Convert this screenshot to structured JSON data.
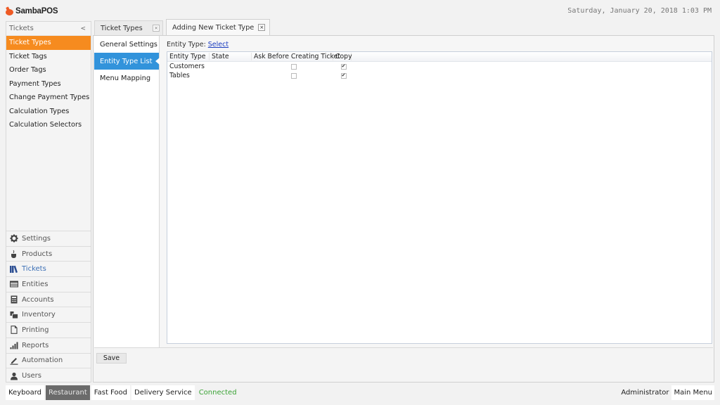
{
  "app": {
    "title": "SambaPOS",
    "datetime": "Saturday, January 20, 2018 1:03 PM"
  },
  "sidebar": {
    "header": "Tickets",
    "collapse_icon": "chevron-left-icon",
    "collapse_glyph": "<",
    "sub_items": [
      {
        "label": "Ticket Types",
        "active": true
      },
      {
        "label": "Ticket Tags"
      },
      {
        "label": "Order Tags"
      },
      {
        "label": "Payment Types"
      },
      {
        "label": "Change Payment Types"
      },
      {
        "label": "Calculation Types"
      },
      {
        "label": "Calculation Selectors"
      }
    ],
    "nav_items": [
      {
        "label": "Settings",
        "icon": "gear-icon"
      },
      {
        "label": "Products",
        "icon": "coffee-cup-icon"
      },
      {
        "label": "Tickets",
        "icon": "books-icon",
        "active": true
      },
      {
        "label": "Entities",
        "icon": "table-icon"
      },
      {
        "label": "Accounts",
        "icon": "calculator-icon"
      },
      {
        "label": "Inventory",
        "icon": "boxes-icon"
      },
      {
        "label": "Printing",
        "icon": "document-icon"
      },
      {
        "label": "Reports",
        "icon": "bar-chart-icon"
      },
      {
        "label": "Automation",
        "icon": "pen-icon"
      },
      {
        "label": "Users",
        "icon": "user-icon"
      }
    ]
  },
  "doc_tabs": [
    {
      "label": "Ticket Types",
      "close": "×"
    },
    {
      "label": "Adding New Ticket Type",
      "close": "×",
      "active": true
    }
  ],
  "inner_tabs": [
    {
      "label": "General Settings"
    },
    {
      "label": "Entity Type List",
      "active": true
    },
    {
      "label": "Menu Mapping"
    }
  ],
  "entity": {
    "label": "Entity Type:",
    "select_link": "Select"
  },
  "grid": {
    "columns": [
      "Entity Type",
      "State",
      "Ask Before Creating Ticket",
      "Copy"
    ],
    "rows": [
      {
        "entity_type": "Customers",
        "state": "",
        "ask_before_creating_ticket": false,
        "copy": true
      },
      {
        "entity_type": "Tables",
        "state": "",
        "ask_before_creating_ticket": false,
        "copy": true
      }
    ],
    "check_glyph": "✔"
  },
  "save_label": "Save",
  "bottom": {
    "buttons": [
      {
        "label": "Keyboard"
      },
      {
        "label": "Restaurant",
        "active": true
      },
      {
        "label": "Fast Food"
      },
      {
        "label": "Delivery Service"
      }
    ],
    "status": "Connected",
    "status_color": "#3aa335",
    "user": "Administrator",
    "main_menu": "Main Menu"
  },
  "colors": {
    "accent_orange": "#f68b1f",
    "accent_blue": "#3293db",
    "link_blue": "#1a3cbf"
  }
}
